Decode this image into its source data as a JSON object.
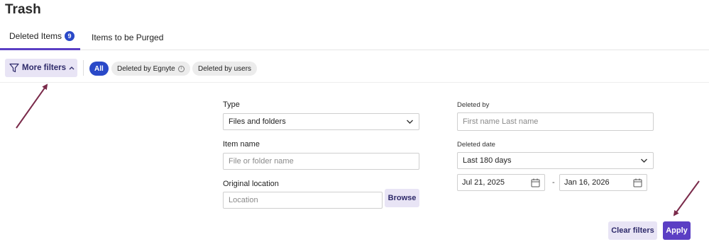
{
  "page": {
    "title": "Trash"
  },
  "tabs": [
    {
      "label": "Deleted Items",
      "count": "9"
    },
    {
      "label": "Items to be Purged"
    }
  ],
  "toolbar": {
    "more_filters_label": "More filters",
    "chips": [
      "All",
      "Deleted by Egnyte",
      "Deleted by users"
    ],
    "info_glyph": "i"
  },
  "filters": {
    "type": {
      "label": "Type",
      "value": "Files and folders"
    },
    "item_name": {
      "label": "Item name",
      "placeholder": "File or folder name"
    },
    "original_location": {
      "label": "Original location",
      "placeholder": "Location",
      "browse_label": "Browse"
    },
    "deleted_by": {
      "label": "Deleted by",
      "placeholder": "First name Last name"
    },
    "deleted_date": {
      "label": "Deleted date",
      "value": "Last 180 days",
      "from": "Jul 21, 2025",
      "separator": "-",
      "to": "Jan 16, 2026"
    }
  },
  "actions": {
    "clear_label": "Clear filters",
    "apply_label": "Apply"
  },
  "colors": {
    "accent": "#5b3fc4",
    "badge": "#2a49c8",
    "button_light": "#e8e4f5",
    "annotation_arrow": "#7a2a4a"
  },
  "icons": [
    "funnel-icon",
    "chevron-up-icon",
    "info-icon",
    "chevron-down-icon",
    "calendar-icon",
    "annotation-arrow"
  ]
}
